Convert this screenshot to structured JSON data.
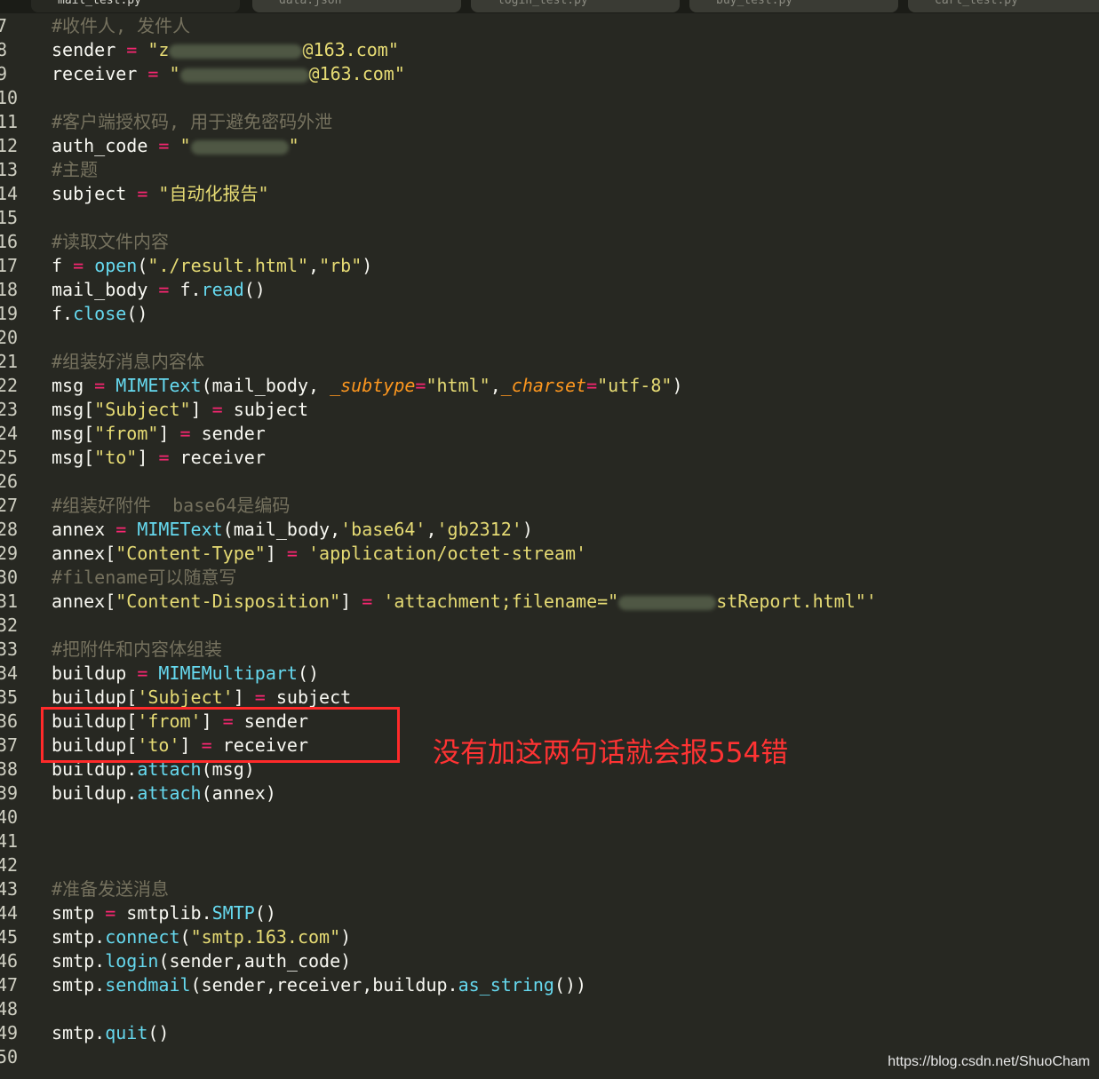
{
  "tabs": [
    {
      "label": "mail_test.py",
      "active": true
    },
    {
      "label": "data.json",
      "active": false
    },
    {
      "label": "login_test.py",
      "active": false
    },
    {
      "label": "buy_test.py",
      "active": false
    },
    {
      "label": "cart_test.py",
      "active": false
    }
  ],
  "colors": {
    "background": "#272822",
    "line_number": "#cfcfc2",
    "text": "#f8f8f2",
    "comment": "#75715e",
    "string": "#e6db74",
    "keyword": "#f92672",
    "function": "#66d9ef",
    "parameter": "#fd971f",
    "annotation": "#ff3333"
  },
  "lines": [
    {
      "n": "7",
      "t": [
        {
          "c": "cm",
          "v": "#收件人, 发件人"
        }
      ]
    },
    {
      "n": "8",
      "t": [
        {
          "v": "sender "
        },
        {
          "c": "kw",
          "v": "="
        },
        {
          "v": " "
        },
        {
          "c": "st",
          "v": "\"z"
        },
        {
          "blur": 150
        },
        {
          "c": "st",
          "v": "@163.com\""
        }
      ]
    },
    {
      "n": "9",
      "t": [
        {
          "v": "receiver "
        },
        {
          "c": "kw",
          "v": "="
        },
        {
          "v": " "
        },
        {
          "c": "st",
          "v": "\""
        },
        {
          "blur": 145
        },
        {
          "c": "st",
          "v": "@163.com\""
        }
      ]
    },
    {
      "n": "10",
      "t": []
    },
    {
      "n": "11",
      "t": [
        {
          "c": "cm",
          "v": "#客户端授权码, 用于避免密码外泄"
        }
      ]
    },
    {
      "n": "12",
      "t": [
        {
          "v": "auth_code "
        },
        {
          "c": "kw",
          "v": "="
        },
        {
          "v": " "
        },
        {
          "c": "st",
          "v": "\""
        },
        {
          "blur": 110
        },
        {
          "c": "st",
          "v": "\""
        }
      ]
    },
    {
      "n": "13",
      "t": [
        {
          "c": "cm",
          "v": "#主题"
        }
      ]
    },
    {
      "n": "14",
      "t": [
        {
          "v": "subject "
        },
        {
          "c": "kw",
          "v": "="
        },
        {
          "v": " "
        },
        {
          "c": "st",
          "v": "\"自动化报告\""
        }
      ]
    },
    {
      "n": "15",
      "t": []
    },
    {
      "n": "16",
      "t": [
        {
          "c": "cm",
          "v": "#读取文件内容"
        }
      ]
    },
    {
      "n": "17",
      "t": [
        {
          "v": "f "
        },
        {
          "c": "kw",
          "v": "="
        },
        {
          "v": " "
        },
        {
          "c": "fn",
          "v": "open"
        },
        {
          "v": "("
        },
        {
          "c": "st",
          "v": "\"./result.html\""
        },
        {
          "v": ","
        },
        {
          "c": "st",
          "v": "\"rb\""
        },
        {
          "v": ")"
        }
      ]
    },
    {
      "n": "18",
      "t": [
        {
          "v": "mail_body "
        },
        {
          "c": "kw",
          "v": "="
        },
        {
          "v": " f."
        },
        {
          "c": "fn",
          "v": "read"
        },
        {
          "v": "()"
        }
      ]
    },
    {
      "n": "19",
      "t": [
        {
          "v": "f."
        },
        {
          "c": "fn",
          "v": "close"
        },
        {
          "v": "()"
        }
      ]
    },
    {
      "n": "20",
      "t": []
    },
    {
      "n": "21",
      "t": [
        {
          "c": "cm",
          "v": "#组装好消息内容体"
        }
      ]
    },
    {
      "n": "22",
      "t": [
        {
          "v": "msg "
        },
        {
          "c": "kw",
          "v": "="
        },
        {
          "v": " "
        },
        {
          "c": "fn",
          "v": "MIMEText"
        },
        {
          "v": "(mail_body, "
        },
        {
          "c": "pa",
          "v": "_subtype"
        },
        {
          "c": "kw",
          "v": "="
        },
        {
          "c": "st",
          "v": "\"html\""
        },
        {
          "v": ","
        },
        {
          "c": "pa",
          "v": "_charset"
        },
        {
          "c": "kw",
          "v": "="
        },
        {
          "c": "st",
          "v": "\"utf-8\""
        },
        {
          "v": ")"
        }
      ]
    },
    {
      "n": "23",
      "t": [
        {
          "v": "msg["
        },
        {
          "c": "st",
          "v": "\"Subject\""
        },
        {
          "v": "] "
        },
        {
          "c": "kw",
          "v": "="
        },
        {
          "v": " subject"
        }
      ]
    },
    {
      "n": "24",
      "t": [
        {
          "v": "msg["
        },
        {
          "c": "st",
          "v": "\"from\""
        },
        {
          "v": "] "
        },
        {
          "c": "kw",
          "v": "="
        },
        {
          "v": " sender"
        }
      ]
    },
    {
      "n": "25",
      "t": [
        {
          "v": "msg["
        },
        {
          "c": "st",
          "v": "\"to\""
        },
        {
          "v": "] "
        },
        {
          "c": "kw",
          "v": "="
        },
        {
          "v": " receiver"
        }
      ]
    },
    {
      "n": "26",
      "t": []
    },
    {
      "n": "27",
      "t": [
        {
          "c": "cm",
          "v": "#组装好附件  base64是编码"
        }
      ]
    },
    {
      "n": "28",
      "t": [
        {
          "v": "annex "
        },
        {
          "c": "kw",
          "v": "="
        },
        {
          "v": " "
        },
        {
          "c": "fn",
          "v": "MIMEText"
        },
        {
          "v": "(mail_body,"
        },
        {
          "c": "st",
          "v": "'base64'"
        },
        {
          "v": ","
        },
        {
          "c": "st",
          "v": "'gb2312'"
        },
        {
          "v": ")"
        }
      ]
    },
    {
      "n": "29",
      "t": [
        {
          "v": "annex["
        },
        {
          "c": "st",
          "v": "\"Content-Type\""
        },
        {
          "v": "] "
        },
        {
          "c": "kw",
          "v": "="
        },
        {
          "v": " "
        },
        {
          "c": "st",
          "v": "'application/octet-stream'"
        }
      ]
    },
    {
      "n": "30",
      "t": [
        {
          "c": "cm",
          "v": "#filename可以随意写"
        }
      ]
    },
    {
      "n": "31",
      "t": [
        {
          "v": "annex["
        },
        {
          "c": "st",
          "v": "\"Content-Disposition\""
        },
        {
          "v": "] "
        },
        {
          "c": "kw",
          "v": "="
        },
        {
          "v": " "
        },
        {
          "c": "st",
          "v": "'attachment;filename=\""
        },
        {
          "blur": 110
        },
        {
          "c": "st",
          "v": "stReport.html\"'"
        }
      ]
    },
    {
      "n": "32",
      "t": []
    },
    {
      "n": "33",
      "t": [
        {
          "c": "cm",
          "v": "#把附件和内容体组装"
        }
      ]
    },
    {
      "n": "34",
      "t": [
        {
          "v": "buildup "
        },
        {
          "c": "kw",
          "v": "="
        },
        {
          "v": " "
        },
        {
          "c": "fn",
          "v": "MIMEMultipart"
        },
        {
          "v": "()"
        }
      ]
    },
    {
      "n": "35",
      "t": [
        {
          "v": "buildup["
        },
        {
          "c": "st",
          "v": "'Subject'"
        },
        {
          "v": "] "
        },
        {
          "c": "kw",
          "v": "="
        },
        {
          "v": " subject"
        }
      ]
    },
    {
      "n": "36",
      "t": [
        {
          "v": "buildup["
        },
        {
          "c": "st",
          "v": "'from'"
        },
        {
          "v": "] "
        },
        {
          "c": "kw",
          "v": "="
        },
        {
          "v": " sender"
        }
      ]
    },
    {
      "n": "37",
      "t": [
        {
          "v": "buildup["
        },
        {
          "c": "st",
          "v": "'to'"
        },
        {
          "v": "] "
        },
        {
          "c": "kw",
          "v": "="
        },
        {
          "v": " receiver"
        }
      ]
    },
    {
      "n": "38",
      "t": [
        {
          "v": "buildup."
        },
        {
          "c": "fn",
          "v": "attach"
        },
        {
          "v": "(msg)"
        }
      ]
    },
    {
      "n": "39",
      "t": [
        {
          "v": "buildup."
        },
        {
          "c": "fn",
          "v": "attach"
        },
        {
          "v": "(annex)"
        }
      ]
    },
    {
      "n": "40",
      "t": []
    },
    {
      "n": "41",
      "t": []
    },
    {
      "n": "42",
      "t": []
    },
    {
      "n": "43",
      "t": [
        {
          "c": "cm",
          "v": "#准备发送消息"
        }
      ]
    },
    {
      "n": "44",
      "t": [
        {
          "v": "smtp "
        },
        {
          "c": "kw",
          "v": "="
        },
        {
          "v": " smtplib."
        },
        {
          "c": "fn",
          "v": "SMTP"
        },
        {
          "v": "()"
        }
      ]
    },
    {
      "n": "45",
      "t": [
        {
          "v": "smtp."
        },
        {
          "c": "fn",
          "v": "connect"
        },
        {
          "v": "("
        },
        {
          "c": "st",
          "v": "\"smtp.163.com\""
        },
        {
          "v": ")"
        }
      ]
    },
    {
      "n": "46",
      "t": [
        {
          "v": "smtp."
        },
        {
          "c": "fn",
          "v": "login"
        },
        {
          "v": "(sender,auth_code)"
        }
      ]
    },
    {
      "n": "47",
      "t": [
        {
          "v": "smtp."
        },
        {
          "c": "fn",
          "v": "sendmail"
        },
        {
          "v": "(sender,receiver,buildup."
        },
        {
          "c": "fn",
          "v": "as_string"
        },
        {
          "v": "())"
        }
      ]
    },
    {
      "n": "48",
      "t": []
    },
    {
      "n": "49",
      "t": [
        {
          "v": "smtp."
        },
        {
          "c": "fn",
          "v": "quit"
        },
        {
          "v": "()"
        }
      ]
    },
    {
      "n": "50",
      "t": []
    }
  ],
  "annotation": "没有加这两句话就会报554错",
  "watermark": "https://blog.csdn.net/ShuoCham"
}
